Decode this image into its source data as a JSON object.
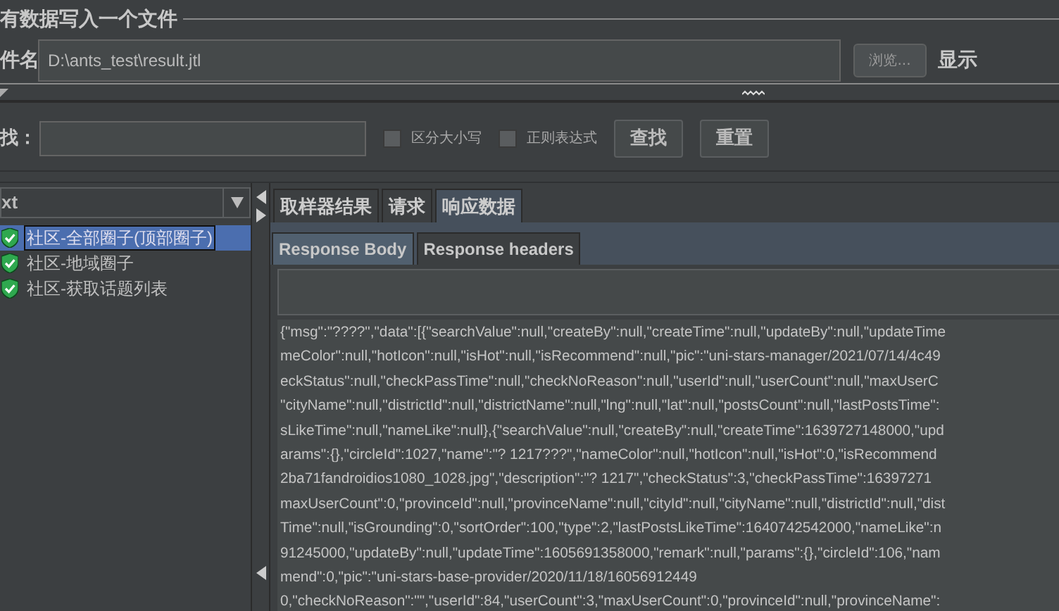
{
  "file_panel": {
    "title": "有数据写入一个文件",
    "filename_label": "件名",
    "filename": "D:\\ants_test\\result.jtl",
    "browse_button": "浏览...",
    "display_label": "显示"
  },
  "search": {
    "label": "找：",
    "options": [
      {
        "label": "区分大小写",
        "checked": false
      },
      {
        "label": "正则表达式",
        "checked": false
      }
    ],
    "buttons": [
      "查找",
      "重置"
    ]
  },
  "tree": {
    "renderer": "xt",
    "items": [
      {
        "label": "社区-全部圈子(顶部圈子)",
        "selected": true
      },
      {
        "label": "社区-地域圈子",
        "selected": false
      },
      {
        "label": "社区-获取话题列表",
        "selected": false
      }
    ]
  },
  "tabs": [
    {
      "label": "取样器结果",
      "selected": false
    },
    {
      "label": "请求",
      "selected": false
    },
    {
      "label": "响应数据",
      "selected": true
    }
  ],
  "subtabs": [
    {
      "label": "Response Body",
      "selected": true
    },
    {
      "label": "Response headers",
      "selected": false
    }
  ],
  "response_lines": [
    "{\"msg\":\"????\",\"data\":[{\"searchValue\":null,\"createBy\":null,\"createTime\":null,\"updateBy\":null,\"updateTime",
    "meColor\":null,\"hotIcon\":null,\"isHot\":null,\"isRecommend\":null,\"pic\":\"uni-stars-manager/2021/07/14/4c49",
    "eckStatus\":null,\"checkPassTime\":null,\"checkNoReason\":null,\"userId\":null,\"userCount\":null,\"maxUserC",
    "\"cityName\":null,\"districtId\":null,\"districtName\":null,\"lng\":null,\"lat\":null,\"postsCount\":null,\"lastPostsTime\":",
    "sLikeTime\":null,\"nameLike\":null},{\"searchValue\":null,\"createBy\":null,\"createTime\":1639727148000,\"upd",
    "arams\":{},\"circleId\":1027,\"name\":\"?  1217???\",\"nameColor\":null,\"hotIcon\":null,\"isHot\":0,\"isRecommend",
    "2ba71fandroidios1080_1028.jpg\",\"description\":\"?  1217\",\"checkStatus\":3,\"checkPassTime\":16397271",
    "maxUserCount\":0,\"provinceId\":null,\"provinceName\":null,\"cityId\":null,\"cityName\":null,\"districtId\":null,\"dist",
    "Time\":null,\"isGrounding\":0,\"sortOrder\":100,\"type\":2,\"lastPostsLikeTime\":1640742542000,\"nameLike\":n",
    "91245000,\"updateBy\":null,\"updateTime\":1605691358000,\"remark\":null,\"params\":{},\"circleId\":106,\"nam",
    "mend\":0,\"pic\":\"uni-stars-base-provider/2020/11/18/16056912449",
    "0,\"checkNoReason\":\"\",\"userId\":84,\"userCount\":3,\"maxUserCount\":0,\"provinceId\":null,\"provinceName\":"
  ]
}
